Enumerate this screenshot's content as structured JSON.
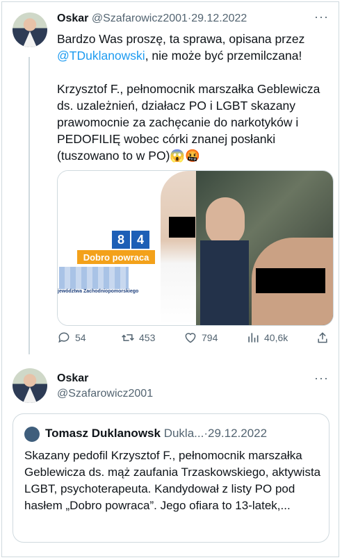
{
  "tweet1": {
    "display_name": "Oskar",
    "handle": "@Szafarowicz2001",
    "separator": "·",
    "date": "29.12.2022",
    "more": "···",
    "text_part1": "Bardzo Was proszę, ta sprawa, opisana przez",
    "mention": "@TDuklanowski",
    "text_part2": ", nie może być przemilczana!",
    "text_part3": "Krzysztof F., pełnomocnik marszałka Geblewicza ds. uzależnień, działacz PO i LGBT skazany prawomocnie za zachęcanie do narkotyków i PEDOFILIĘ wobec córki znanej posłanki (tuszowano to w PO)😱🤬",
    "media": {
      "logo_number_1": "8",
      "logo_number_2": "4",
      "slogan": "Dobro powraca",
      "caption": "jewództwa Zachodniopomorskiego"
    },
    "actions": {
      "replies": "54",
      "retweets": "453",
      "likes": "794",
      "views": "40,6k"
    }
  },
  "tweet2": {
    "display_name": "Oskar",
    "handle": "@Szafarowicz2001",
    "more": "···"
  },
  "quote": {
    "name": "Tomasz Duklanowsk",
    "handle": "Dukla...",
    "separator": "·",
    "date": "29.12.2022",
    "text": "Skazany pedofil Krzysztof F., pełnomocnik marszałka Geblewicza ds. mąż zaufania Trzaskowskiego, aktywista LGBT, psychoterapeuta. Kandydował z listy PO pod hasłem „Dobro powraca”. Jego ofiara to 13-latek,..."
  },
  "colors": {
    "accent": "#1d9bf0",
    "muted": "#536471",
    "border": "#cfd9de"
  }
}
